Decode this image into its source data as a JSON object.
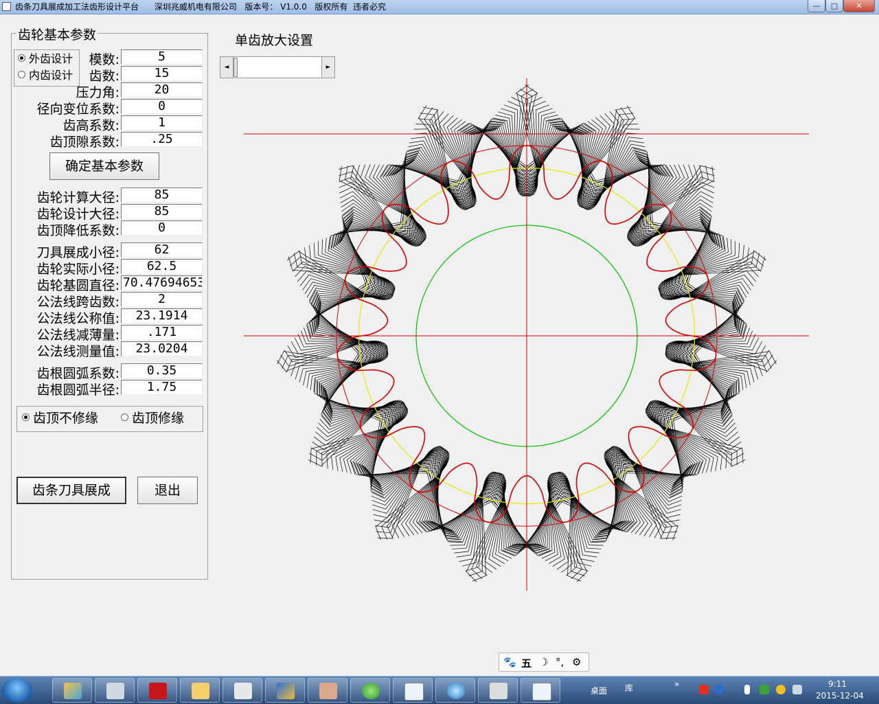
{
  "window": {
    "title": "齿条刀具展成加工法齿形设计平台      深圳兆威机电有限公司   版本号： V1.0.0   版权所有  违者必究",
    "min_glyph": "—",
    "max_glyph": "□",
    "close_glyph": "✕"
  },
  "params": {
    "group_title": "齿轮基本参数",
    "radio_external": "外齿设计",
    "radio_internal": "内齿设计",
    "module_label": "模数:",
    "module_value": "5",
    "teeth_label": "齿数:",
    "teeth_value": "15",
    "pressure_label": "压力角:",
    "pressure_value": "20",
    "shift_label": "径向变位系数:",
    "shift_value": "0",
    "addendum_label": "齿高系数:",
    "addendum_value": "1",
    "clearance_label": "齿顶隙系数:",
    "clearance_value": ".25",
    "confirm_button": "确定基本参数",
    "calc_od_label": "齿轮计算大径:",
    "calc_od_value": "85",
    "design_od_label": "齿轮设计大径:",
    "design_od_value": "85",
    "tip_reduce_label": "齿顶降低系数:",
    "tip_reduce_value": "0",
    "tool_minor_label": "刀具展成小径:",
    "tool_minor_value": "62",
    "actual_minor_label": "齿轮实际小径:",
    "actual_minor_value": "62.5",
    "base_dia_label": "齿轮基圆直径:",
    "base_dia_value": "70.47694653",
    "span_teeth_label": "公法线跨齿数:",
    "span_teeth_value": "2",
    "nominal_label": "公法线公称值:",
    "nominal_value": "23.1914",
    "thin_label": "公法线减薄量:",
    "thin_value": ".171",
    "measured_label": "公法线测量值:",
    "measured_value": "23.0204",
    "fillet_coef_label": "齿根圆弧系数:",
    "fillet_coef_value": "0.35",
    "fillet_radius_label": "齿根圆弧半径:",
    "fillet_radius_value": "1.75",
    "tip_no_mod": "齿顶不修缘",
    "tip_mod": "齿顶修缘",
    "generate_button": "齿条刀具展成",
    "exit_button": "退出"
  },
  "zoom": {
    "label": "单齿放大设置",
    "left_arrow": "◄",
    "right_arrow": "►"
  },
  "drawing": {
    "tooth_count": 15,
    "module": 5,
    "pressure_angle_deg": 20,
    "pitch_diameter": 75,
    "outer_diameter": 85,
    "root_diameter": 62.5,
    "base_diameter": 70.47694653,
    "colors": {
      "envelope": "#000000",
      "profile": "#d40000",
      "axes": "#d40000",
      "outer_circle": "#d40000",
      "pitch_circle": "#e8e800",
      "root_circle": "#00c000"
    }
  },
  "ime": {
    "paw": "🐾",
    "five": "五",
    "moon": "☽",
    "dots": "°,",
    "gear": "⚙"
  },
  "taskbar": {
    "desktop": "桌面",
    "library": "库",
    "chevron": "»",
    "time": "9:11",
    "date": "2015-12-04"
  }
}
